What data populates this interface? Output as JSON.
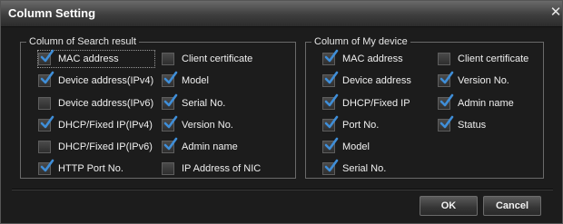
{
  "dialog": {
    "title": "Column Setting"
  },
  "search_result": {
    "label": "Column of Search result",
    "items": [
      {
        "label": "MAC address",
        "checked": true
      },
      {
        "label": "Device address(IPv4)",
        "checked": true
      },
      {
        "label": "Device address(IPv6)",
        "checked": false
      },
      {
        "label": "DHCP/Fixed IP(IPv4)",
        "checked": true
      },
      {
        "label": "DHCP/Fixed IP(IPv6)",
        "checked": false
      },
      {
        "label": "HTTP Port No.",
        "checked": true
      },
      {
        "label": "Client certificate",
        "checked": false
      },
      {
        "label": "Model",
        "checked": true
      },
      {
        "label": "Serial No.",
        "checked": true
      },
      {
        "label": "Version No.",
        "checked": true
      },
      {
        "label": "Admin name",
        "checked": true
      },
      {
        "label": "IP Address of NIC",
        "checked": false
      }
    ]
  },
  "my_device": {
    "label": "Column of My device",
    "items": [
      {
        "label": "MAC address",
        "checked": true
      },
      {
        "label": "Device address",
        "checked": true
      },
      {
        "label": "DHCP/Fixed IP",
        "checked": true
      },
      {
        "label": "Port No.",
        "checked": true
      },
      {
        "label": "Model",
        "checked": true
      },
      {
        "label": "Serial No.",
        "checked": true
      },
      {
        "label": "Client certificate",
        "checked": false
      },
      {
        "label": "Version No.",
        "checked": true
      },
      {
        "label": "Admin name",
        "checked": true
      },
      {
        "label": "Status",
        "checked": true
      }
    ]
  },
  "buttons": {
    "ok": "OK",
    "cancel": "Cancel"
  },
  "icons": {
    "close": "close-icon",
    "check": "check-icon"
  },
  "colors": {
    "background": "#1c1c1c",
    "check": "#3f8ed8",
    "text": "#f0f0f0"
  }
}
